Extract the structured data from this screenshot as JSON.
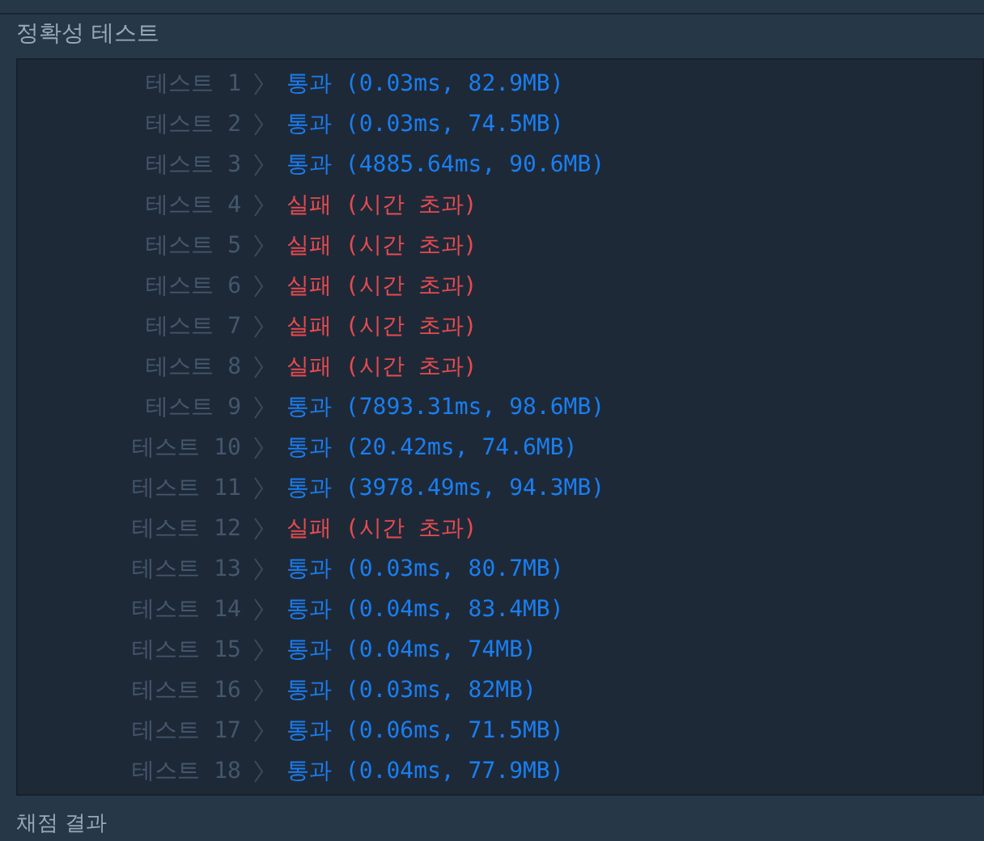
{
  "section_title": "정확성  테스트",
  "tests": [
    {
      "label": "테스트 1",
      "kind": "pass",
      "result": "통과",
      "detail": "(0.03ms, 82.9MB)"
    },
    {
      "label": "테스트 2",
      "kind": "pass",
      "result": "통과",
      "detail": "(0.03ms, 74.5MB)"
    },
    {
      "label": "테스트 3",
      "kind": "pass",
      "result": "통과",
      "detail": "(4885.64ms, 90.6MB)"
    },
    {
      "label": "테스트 4",
      "kind": "fail",
      "result": "실패",
      "detail": "(시간 초과)"
    },
    {
      "label": "테스트 5",
      "kind": "fail",
      "result": "실패",
      "detail": "(시간 초과)"
    },
    {
      "label": "테스트 6",
      "kind": "fail",
      "result": "실패",
      "detail": "(시간 초과)"
    },
    {
      "label": "테스트 7",
      "kind": "fail",
      "result": "실패",
      "detail": "(시간 초과)"
    },
    {
      "label": "테스트 8",
      "kind": "fail",
      "result": "실패",
      "detail": "(시간 초과)"
    },
    {
      "label": "테스트 9",
      "kind": "pass",
      "result": "통과",
      "detail": "(7893.31ms, 98.6MB)"
    },
    {
      "label": "테스트 10",
      "kind": "pass",
      "result": "통과",
      "detail": "(20.42ms, 74.6MB)"
    },
    {
      "label": "테스트 11",
      "kind": "pass",
      "result": "통과",
      "detail": "(3978.49ms, 94.3MB)"
    },
    {
      "label": "테스트 12",
      "kind": "fail",
      "result": "실패",
      "detail": "(시간 초과)"
    },
    {
      "label": "테스트 13",
      "kind": "pass",
      "result": "통과",
      "detail": "(0.03ms, 80.7MB)"
    },
    {
      "label": "테스트 14",
      "kind": "pass",
      "result": "통과",
      "detail": "(0.04ms, 83.4MB)"
    },
    {
      "label": "테스트 15",
      "kind": "pass",
      "result": "통과",
      "detail": "(0.04ms, 74MB)"
    },
    {
      "label": "테스트 16",
      "kind": "pass",
      "result": "통과",
      "detail": "(0.03ms, 82MB)"
    },
    {
      "label": "테스트 17",
      "kind": "pass",
      "result": "통과",
      "detail": "(0.06ms, 71.5MB)"
    },
    {
      "label": "테스트 18",
      "kind": "pass",
      "result": "통과",
      "detail": "(0.04ms, 77.9MB)"
    }
  ],
  "footer_title": "채점 결과"
}
